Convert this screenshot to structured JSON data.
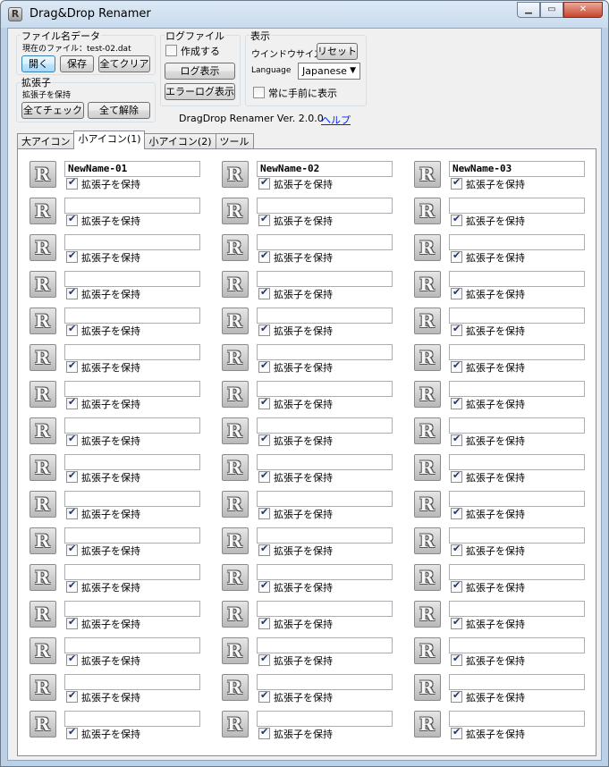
{
  "window": {
    "title": "Drag&Drop Renamer",
    "app_icon_letter": "R",
    "minimize": "▁",
    "maximize": "▭",
    "close": "✕"
  },
  "filename_data": {
    "label": "ファイル名データ",
    "current_file": "現在のファイル：test-02.dat",
    "open": "開く",
    "save": "保存",
    "clear_all": "全てクリア"
  },
  "extension": {
    "label": "拡張子",
    "keep_label": "拡張子を保持",
    "check_all": "全てチェック",
    "uncheck_all": "全て解除"
  },
  "log_file": {
    "label": "ログファイル",
    "create_label": "作成する",
    "create_checked": false,
    "show_log": "ログ表示",
    "show_error_log": "エラーログ表示"
  },
  "display": {
    "label": "表示",
    "window_size_label": "ウインドウサイズ",
    "reset": "リセット",
    "language_label": "Language",
    "language_value": "Japanese",
    "topmost_label": "常に手前に表示",
    "topmost_checked": false
  },
  "version": "DragDrop Renamer Ver. 2.0.0",
  "help_link": "ヘルプ",
  "tabs": [
    {
      "label": "大アイコン",
      "active": false
    },
    {
      "label": "小アイコン(1)",
      "active": true
    },
    {
      "label": "小アイコン(2)",
      "active": false
    },
    {
      "label": "ツール",
      "active": false
    }
  ],
  "grid": {
    "icon_letter": "R",
    "keep_label": "拡張子を保持",
    "columns": 3,
    "rows": 16,
    "entries": [
      "NewName-01",
      "NewName-02",
      "NewName-03",
      "",
      "",
      "",
      "",
      "",
      "",
      "",
      "",
      "",
      "",
      "",
      "",
      "",
      "",
      "",
      "",
      "",
      "",
      "",
      "",
      "",
      "",
      "",
      "",
      "",
      "",
      "",
      "",
      "",
      "",
      "",
      "",
      "",
      "",
      "",
      "",
      "",
      "",
      "",
      "",
      "",
      "",
      "",
      "",
      ""
    ]
  }
}
